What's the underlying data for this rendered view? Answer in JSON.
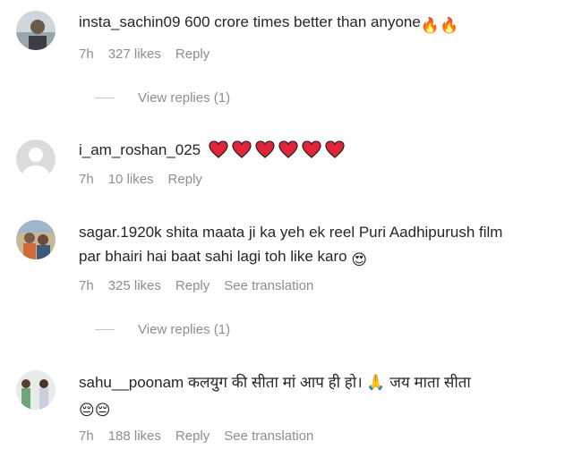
{
  "comments": [
    {
      "username": "insta_sachin09",
      "text": "600 crore times better than anyone",
      "emojis": "🔥🔥",
      "time": "7h",
      "likes": "327 likes",
      "reply_label": "Reply",
      "view_replies": "View replies (1)"
    },
    {
      "username": "i_am_roshan_025",
      "text": "",
      "emojis": "❤❤❤❤❤❤",
      "time": "7h",
      "likes": "10 likes",
      "reply_label": "Reply"
    },
    {
      "username": "sagar.1920k",
      "text": "shita maata ji ka yeh ek reel Puri Aadhipurush film",
      "text_line2": "par bhairi hai baat sahi lagi toh like karo",
      "emojis": "😍",
      "time": "7h",
      "likes": "325 likes",
      "reply_label": "Reply",
      "translation_label": "See translation",
      "view_replies": "View replies (1)"
    },
    {
      "username": "sahu__poonam",
      "text": "कलयुग की सीता मां आप ही हो। 🙏 जय माता सीता",
      "emojis": "😔😔",
      "time": "7h",
      "likes": "188 likes",
      "reply_label": "Reply",
      "translation_label": "See translation"
    }
  ],
  "icons": {
    "heart_color": "#e0243a",
    "fire": "fire-emoji",
    "default_avatar": "default-avatar-icon"
  }
}
